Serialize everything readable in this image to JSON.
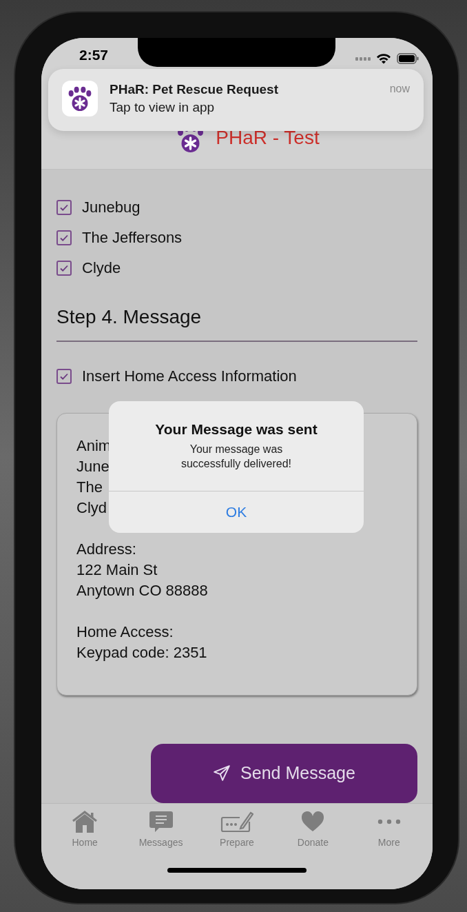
{
  "status_bar": {
    "time": "2:57"
  },
  "notification": {
    "title": "PHaR: Pet Rescue Request",
    "body": "Tap to view in app",
    "time": "now"
  },
  "header": {
    "title": "PHaR - Test"
  },
  "animals": [
    {
      "label": "Junebug",
      "checked": true
    },
    {
      "label": "The Jeffersons",
      "checked": true
    },
    {
      "label": "Clyde",
      "checked": true
    }
  ],
  "step4": {
    "heading": "Step 4. Message",
    "options": [
      {
        "label": "Insert Home Access Information",
        "checked": true
      }
    ]
  },
  "message_paragraphs": [
    [
      "Anim",
      "June",
      "The",
      "Clyd"
    ],
    [
      "Address:",
      "122 Main St",
      "Anytown CO 88888"
    ],
    [
      "Home Access:",
      "Keypad code: 2351"
    ]
  ],
  "send_button": {
    "label": "Send Message"
  },
  "alert": {
    "title": "Your Message was sent",
    "message": "Your message was successfully delivered!",
    "button": "OK"
  },
  "tab_bar": [
    {
      "label": "Home",
      "kind": "home"
    },
    {
      "label": "Messages",
      "kind": "messages"
    },
    {
      "label": "Prepare",
      "kind": "prepare"
    },
    {
      "label": "Donate",
      "kind": "donate"
    },
    {
      "label": "More",
      "kind": "more"
    }
  ]
}
